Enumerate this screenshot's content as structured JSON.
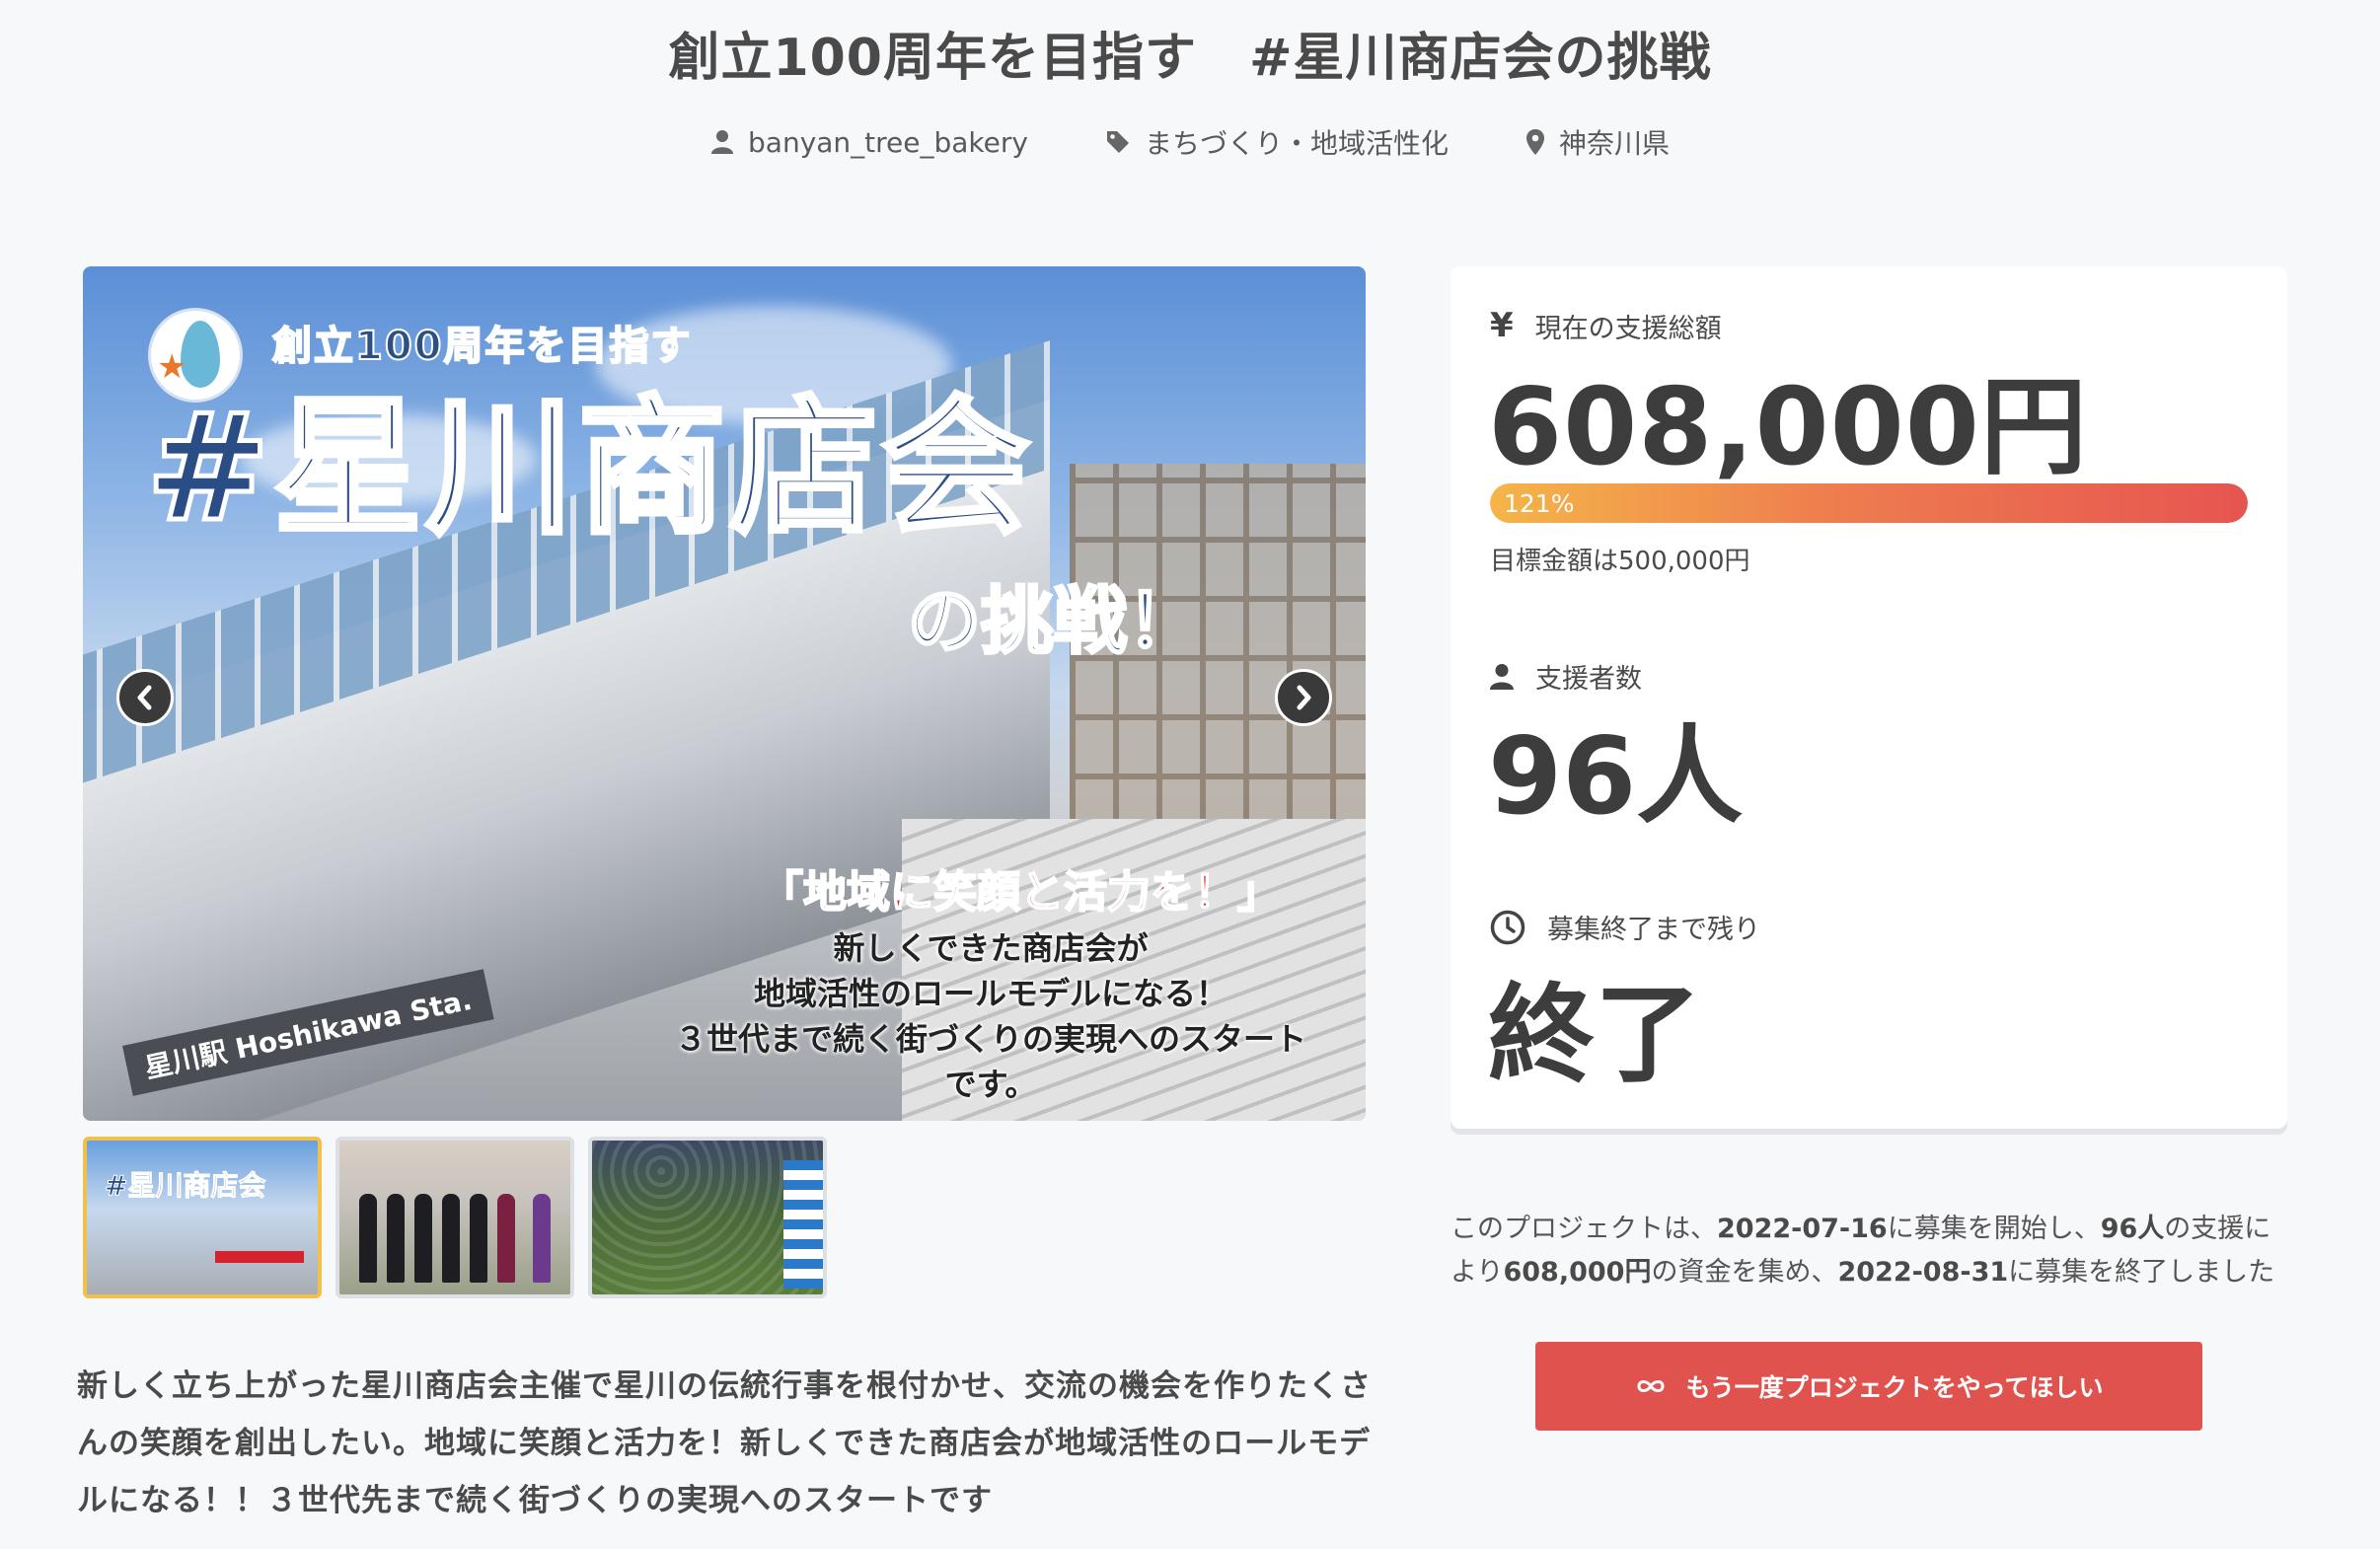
{
  "project": {
    "title": "創立100周年を目指す　#星川商店会の挑戦",
    "owner": "banyan_tree_bakery",
    "category": "まちづくり・地域活性化",
    "location": "神奈川県"
  },
  "hero": {
    "logo_star": "★",
    "banner_sub": "創立100周年を目指す",
    "banner_main": "#星川商店会",
    "banner_sub2": "の挑戦！",
    "station_sign": "星川駅 Hoshikawa Sta.",
    "slogan": "「地域に笑顔と活力を！」",
    "slogan_lines": [
      "新しくできた商店会が",
      "地域活性のロールモデルになる！",
      "３世代まで続く街づくりの実現へのスタートです。"
    ],
    "thumb1_text": "#星川商店会"
  },
  "thumbnails": [
    "thumb-banner",
    "thumb-group-photo",
    "thumb-event-crowd"
  ],
  "description": "新しく立ち上がった星川商店会主催で星川の伝統行事を根付かせ、交流の機会を作りたくさんの笑顔を創出したい。地域に笑顔と活力を！新しくできた商店会が地域活性のロールモデルになる！！３世代先まで続く街づくりの実現へのスタートです",
  "stats": {
    "amount_label": "現在の支援総額",
    "amount_value": "608,000円",
    "progress_text": "121%",
    "progress_fraction": 1.0,
    "target_text": "目標金額は500,000円",
    "backers_label": "支援者数",
    "backers_value": "96人",
    "remaining_label": "募集終了まで残り",
    "remaining_value": "終了"
  },
  "summary": {
    "p1": "このプロジェクトは、",
    "start_date": "2022-07-16",
    "p2": "に募集を開始し、",
    "backers": "96人",
    "p3": "の支援により",
    "amount": "608,000円",
    "p4": "の資金を集め、",
    "end_date": "2022-08-31",
    "p5": "に募集を終了しました"
  },
  "cta": {
    "label": "もう一度プロジェクトをやってほしい",
    "icon": "infinity-icon"
  },
  "colors": {
    "accent": "#e0524e",
    "progress_start": "#f5b548",
    "progress_end": "#e65550",
    "active_thumb": "#f1c14c"
  }
}
